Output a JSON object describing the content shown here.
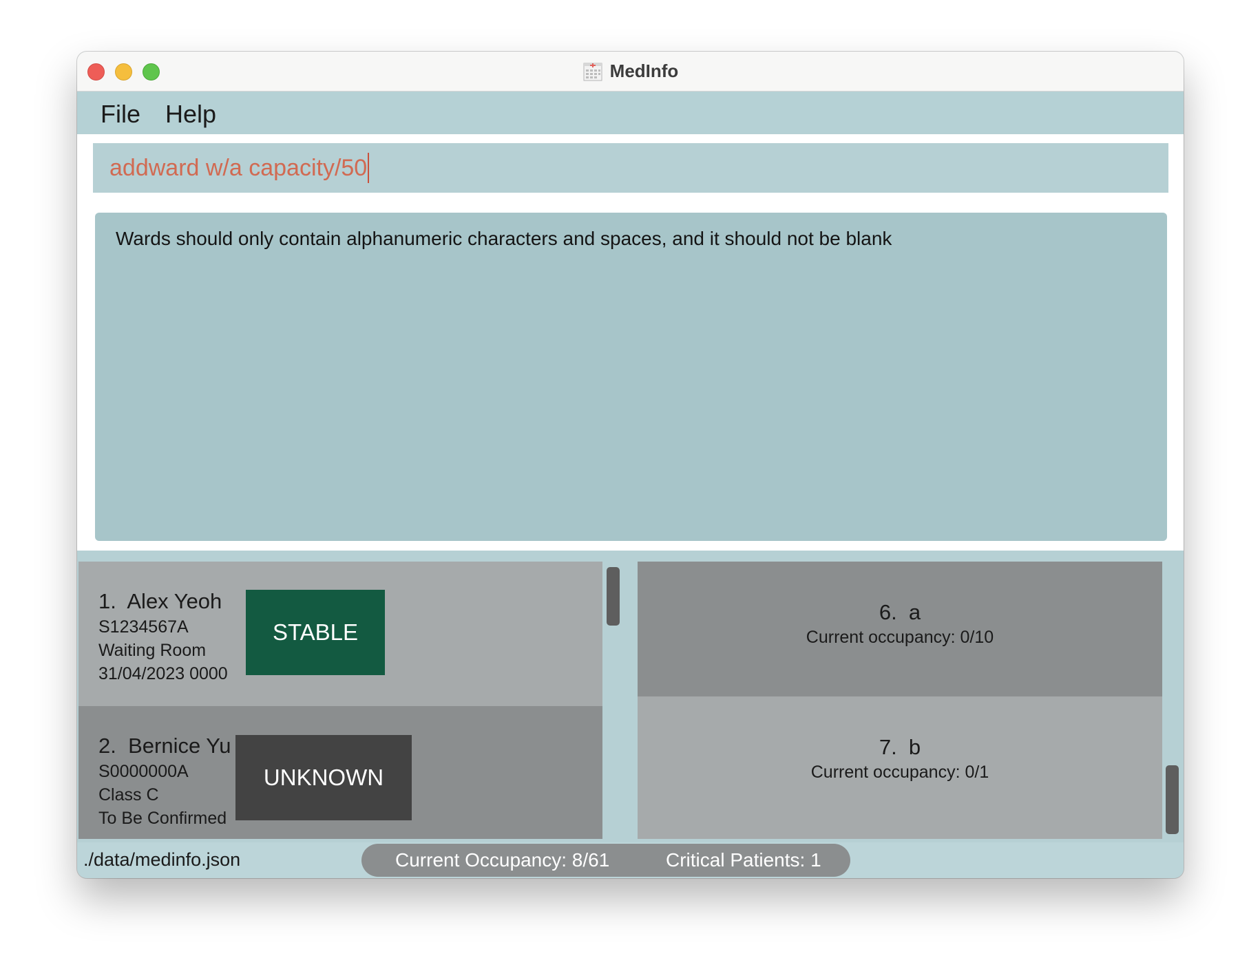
{
  "window": {
    "title": "MedInfo"
  },
  "menu": {
    "file": "File",
    "help": "Help"
  },
  "command": {
    "value": "addward w/a capacity/50"
  },
  "result": {
    "message": "Wards should only contain alphanumeric characters and spaces, and it should not be blank"
  },
  "patients": [
    {
      "index": "1.",
      "name": "Alex Yeoh",
      "nric": "S1234567A",
      "ward": "Waiting Room",
      "discharge": "31/04/2023 0000",
      "status": "STABLE",
      "status_color": "#135a41"
    },
    {
      "index": "2.",
      "name": "Bernice Yu",
      "nric": "S0000000A",
      "ward": "Class C",
      "discharge": "To Be Confirmed",
      "status": "UNKNOWN",
      "status_color": "#434343"
    }
  ],
  "wards": [
    {
      "index": "6.",
      "name": "a",
      "occupancy": "Current occupancy: 0/10"
    },
    {
      "index": "7.",
      "name": "b",
      "occupancy": "Current occupancy: 0/1"
    }
  ],
  "statusbar": {
    "file_path": "./data/medinfo.json",
    "occupancy": "Current Occupancy: 8/61",
    "critical": "Critical Patients: 1"
  },
  "icons": {
    "close": "close-icon",
    "minimize": "minimize-icon",
    "maximize": "maximize-icon",
    "app": "calendar-icon"
  }
}
